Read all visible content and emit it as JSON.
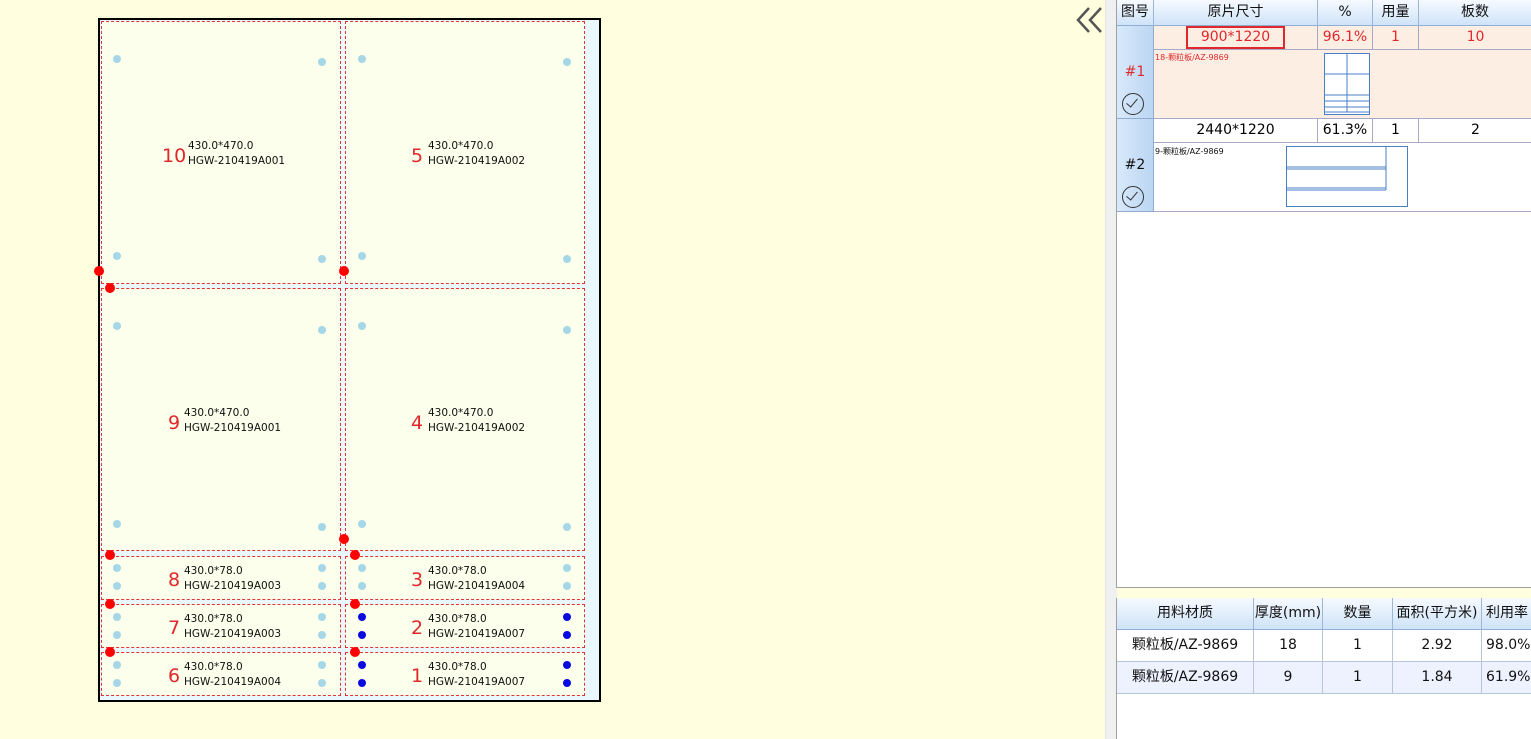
{
  "sheet": {
    "parts": [
      {
        "num": "10",
        "size": "430.0*470.0",
        "code": "HGW-210419A001"
      },
      {
        "num": "5",
        "size": "430.0*470.0",
        "code": "HGW-210419A002"
      },
      {
        "num": "9",
        "size": "430.0*470.0",
        "code": "HGW-210419A001"
      },
      {
        "num": "4",
        "size": "430.0*470.0",
        "code": "HGW-210419A002"
      },
      {
        "num": "8",
        "size": "430.0*78.0",
        "code": "HGW-210419A003"
      },
      {
        "num": "3",
        "size": "430.0*78.0",
        "code": "HGW-210419A004"
      },
      {
        "num": "7",
        "size": "430.0*78.0",
        "code": "HGW-210419A003"
      },
      {
        "num": "2",
        "size": "430.0*78.0",
        "code": "HGW-210419A007"
      },
      {
        "num": "6",
        "size": "430.0*78.0",
        "code": "HGW-210419A004"
      },
      {
        "num": "1",
        "size": "430.0*78.0",
        "code": "HGW-210419A007"
      }
    ]
  },
  "plan_table": {
    "headers": {
      "id": "图号",
      "size": "原片尺寸",
      "pct": "%",
      "usage": "用量",
      "boards": "板数"
    },
    "rows": [
      {
        "id": "#1",
        "size": "900*1220",
        "pct": "96.1%",
        "usage": "1",
        "boards": "10",
        "material": "18-颗粒板/AZ-9869",
        "selected": true
      },
      {
        "id": "#2",
        "size": "2440*1220",
        "pct": "61.3%",
        "usage": "1",
        "boards": "2",
        "material": "9-颗粒板/AZ-9869",
        "selected": false
      }
    ]
  },
  "summary_table": {
    "headers": {
      "material": "用料材质",
      "thickness": "厚度(mm)",
      "qty": "数量",
      "area": "面积(平方米)",
      "util": "利用率"
    },
    "rows": [
      {
        "material": "颗粒板/AZ-9869",
        "thickness": "18",
        "qty": "1",
        "area": "2.92",
        "util": "98.0%"
      },
      {
        "material": "颗粒板/AZ-9869",
        "thickness": "9",
        "qty": "1",
        "area": "1.84",
        "util": "61.9%"
      }
    ]
  },
  "colors": {
    "accent_red": "#e0282c",
    "selected_row": "#fdeee4",
    "header_blue": "#cfe3f8",
    "canvas_bg": "#ffffdf"
  },
  "icons": {
    "collapse": "double-chevron-left-icon",
    "check": "check-circle-icon"
  }
}
